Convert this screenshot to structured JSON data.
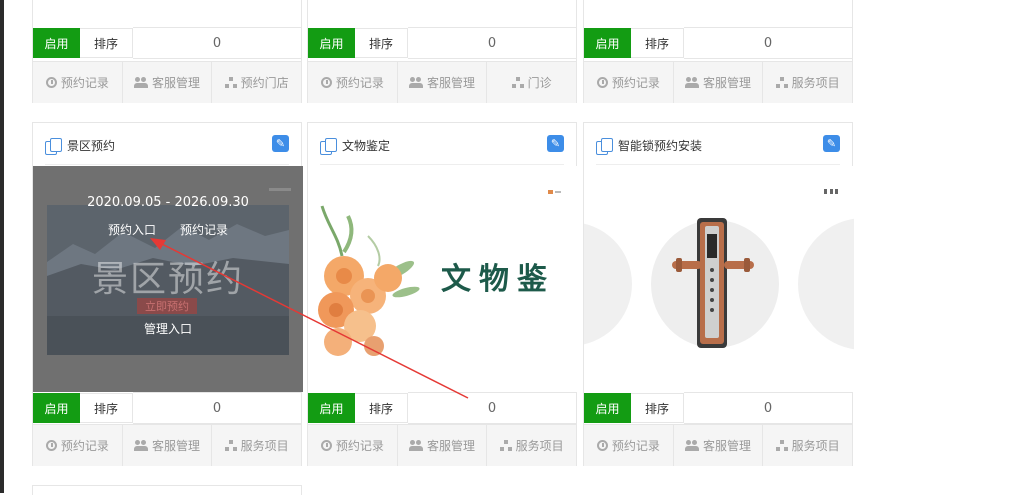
{
  "labels": {
    "enable": "启用",
    "sort": "排序",
    "sort_value": "0",
    "appointment_records": "预约记录",
    "customer_service": "客服管理",
    "appointment_stores": "预约门店",
    "clinic": "门诊",
    "service_items": "服务项目"
  },
  "cards": [
    {
      "title": "景区预约"
    },
    {
      "title": "文物鉴定"
    },
    {
      "title": "智能锁预约安装"
    }
  ],
  "scenic_preview": {
    "date_range": "2020.09.05 - 2026.09.30",
    "entry": "预约入口",
    "records": "预约记录",
    "banner_text": "景区预约",
    "book_now": "立即预约",
    "admin_entry": "管理入口"
  },
  "relic_preview": {
    "banner_text": "文物鉴"
  },
  "colors": {
    "enable_green": "#139c13",
    "edit_blue": "#3d8de8",
    "annotation_arrow": "#e53935"
  }
}
